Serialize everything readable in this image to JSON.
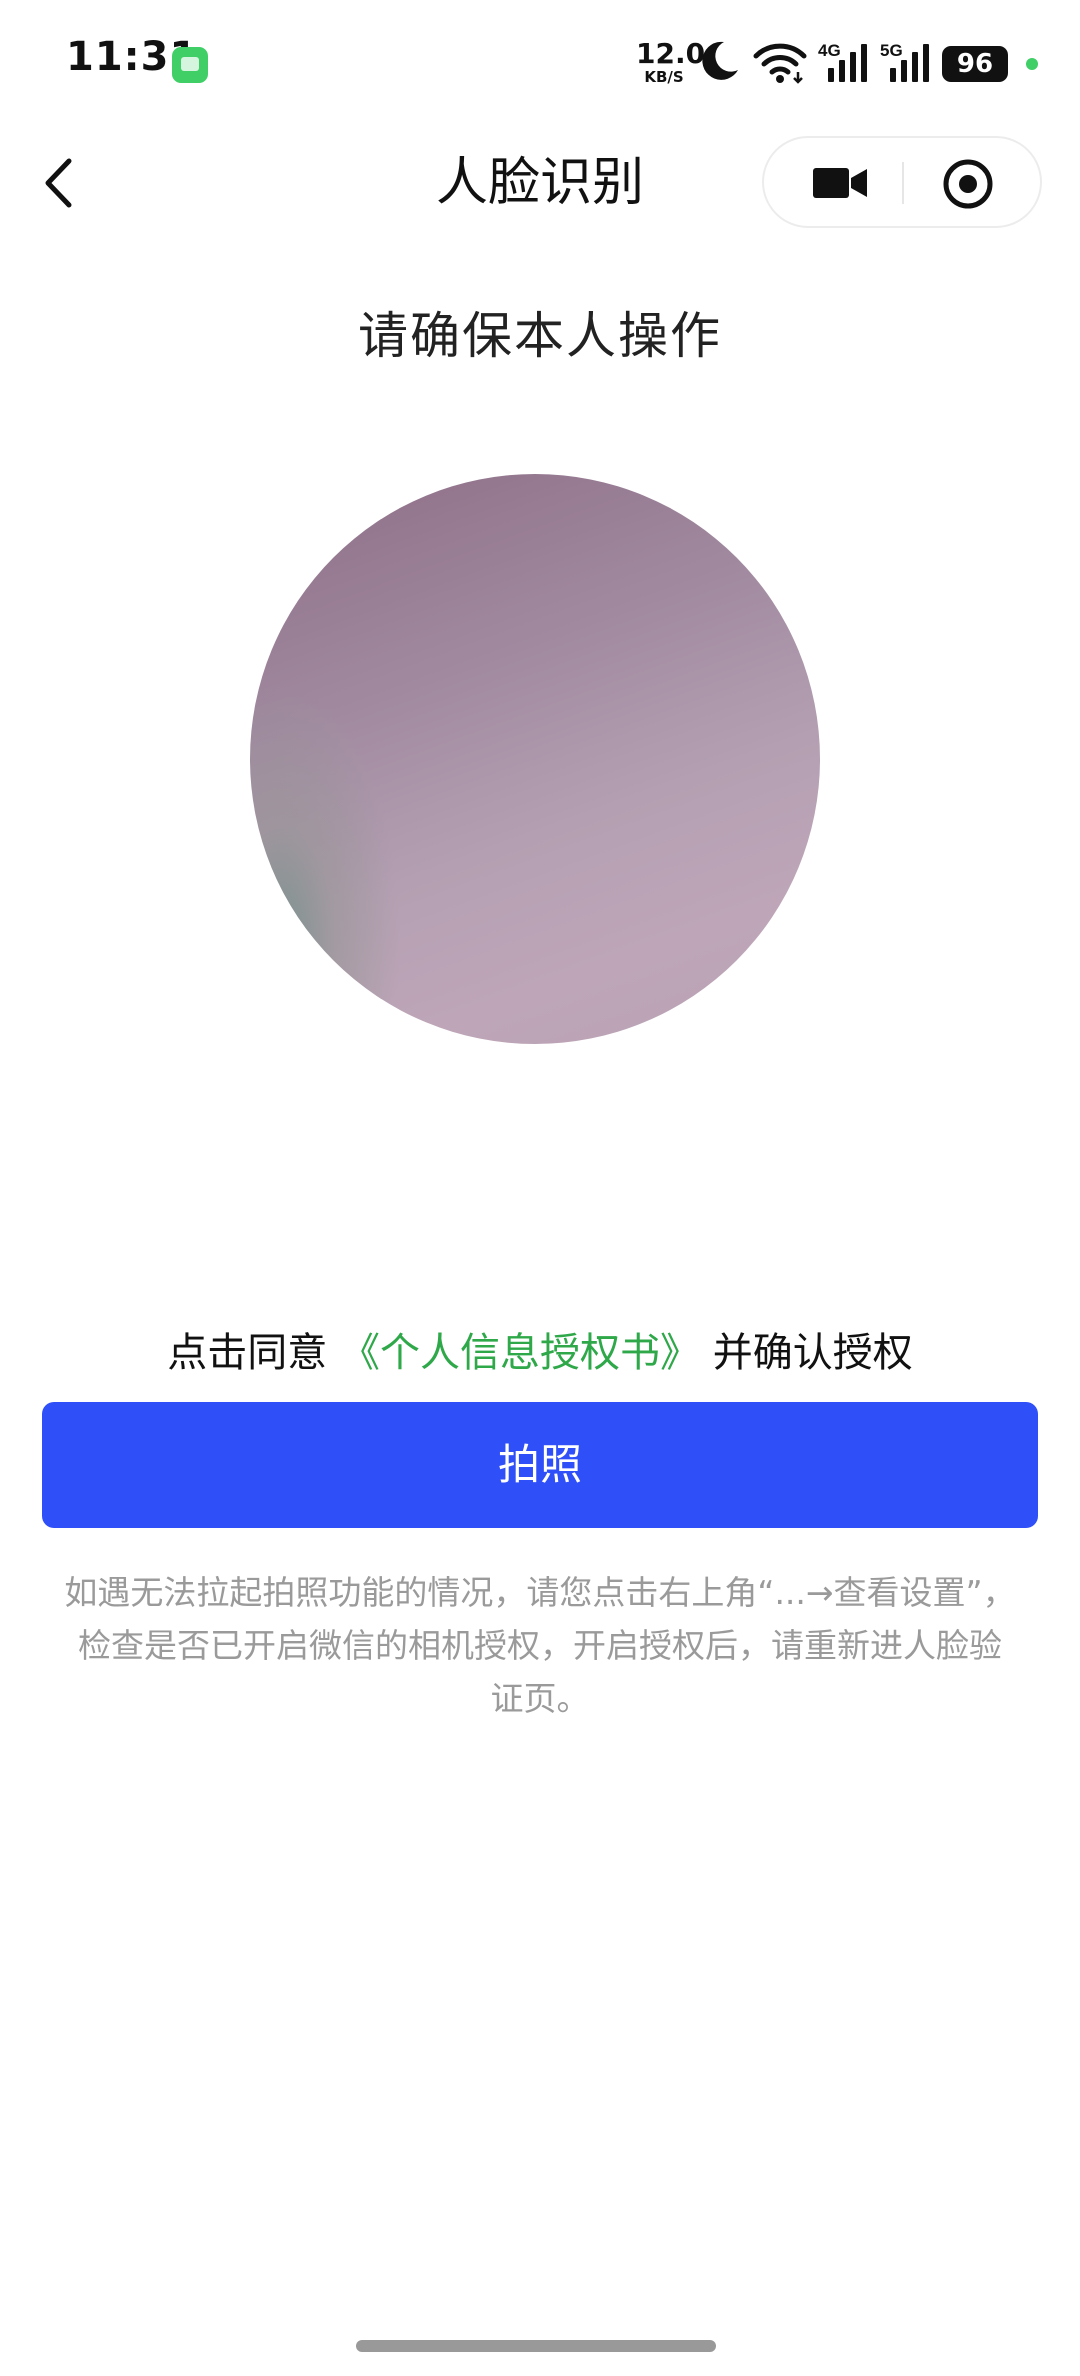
{
  "status_bar": {
    "time": "11:31",
    "net_speed_value": "12.0",
    "net_speed_unit": "KB/S",
    "signal_4g_label": "4G",
    "signal_5g_label": "5G",
    "battery_level": "96",
    "icons": [
      "messages-app-icon",
      "moon-icon",
      "wifi-icon",
      "signal-4g-icon",
      "signal-5g-icon",
      "battery-icon"
    ],
    "accent_green": "#3fcf66"
  },
  "nav": {
    "title": "人脸识别",
    "icons": [
      "back-chevron-icon",
      "video-camera-icon",
      "record-target-icon"
    ]
  },
  "main": {
    "instruction": "请确保本人操作",
    "consent_prefix": "点击同意",
    "consent_link": "《个人信息授权书》",
    "consent_suffix": "并确认授权",
    "photo_button_label": "拍照",
    "help_text": "如遇无法拉起拍照功能的情况，请您点击右上角“...→查看设置”，检查是否已开启微信的相机授权，开启授权后，请重新进人脸验证页。"
  },
  "colors": {
    "primary_button": "#2f4ff8",
    "link_green": "#2fa84a",
    "help_text": "#9a9a9a"
  }
}
